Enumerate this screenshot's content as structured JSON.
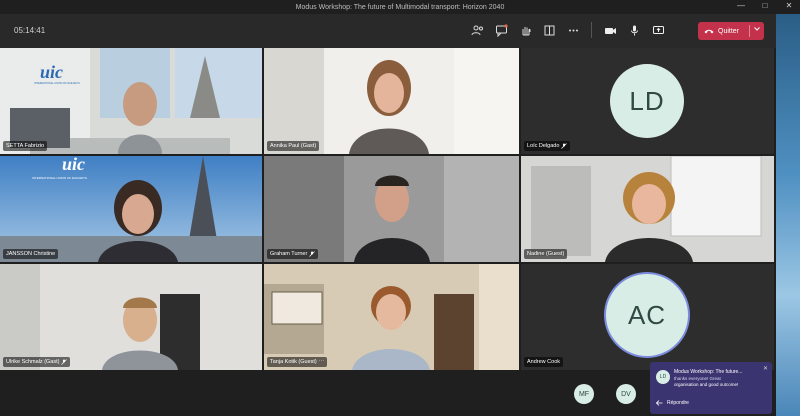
{
  "window": {
    "title": "Modus Workshop: The future of Multimodal transport: Horizon 2040"
  },
  "toolbar": {
    "timer": "05:14:41",
    "leave_label": "Quitter"
  },
  "participants": [
    {
      "name": "SETTA Fabrizio",
      "icon": "none"
    },
    {
      "name": "Annika Paul (Gast)",
      "icon": "none"
    },
    {
      "name": "Loïc Delgado",
      "initials": "LD",
      "icon": "mic-off-icon"
    },
    {
      "name": "JANSSON Christine",
      "icon": "none"
    },
    {
      "name": "Graham Turner",
      "icon": "mic-off-icon"
    },
    {
      "name": "Nadine (Guest)",
      "icon": "none"
    },
    {
      "name": "Ulrike Schmalz (Gast)",
      "icon": "mic-off-icon"
    },
    {
      "name": "Tanja Kotik (Guest)",
      "icon": "more-icon"
    },
    {
      "name": "Andrew Cook",
      "initials": "AC",
      "icon": "none"
    }
  ],
  "overflow": [
    {
      "initials": "MF"
    },
    {
      "initials": "DV"
    }
  ],
  "signs": {
    "uic": "uic",
    "uic_sub": "INTERNATIONAL UNION OF RAILWAYS"
  },
  "toast": {
    "initials": "LD",
    "title": "Modus Workshop: The future...",
    "line1": "thanks everyone! Great",
    "line2": "organisation and good outcome!",
    "reply_label": "Répondre"
  },
  "colors": {
    "leave": "#c4314b",
    "toast": "#3a3470",
    "avatar_bg": "#d9ede7"
  }
}
